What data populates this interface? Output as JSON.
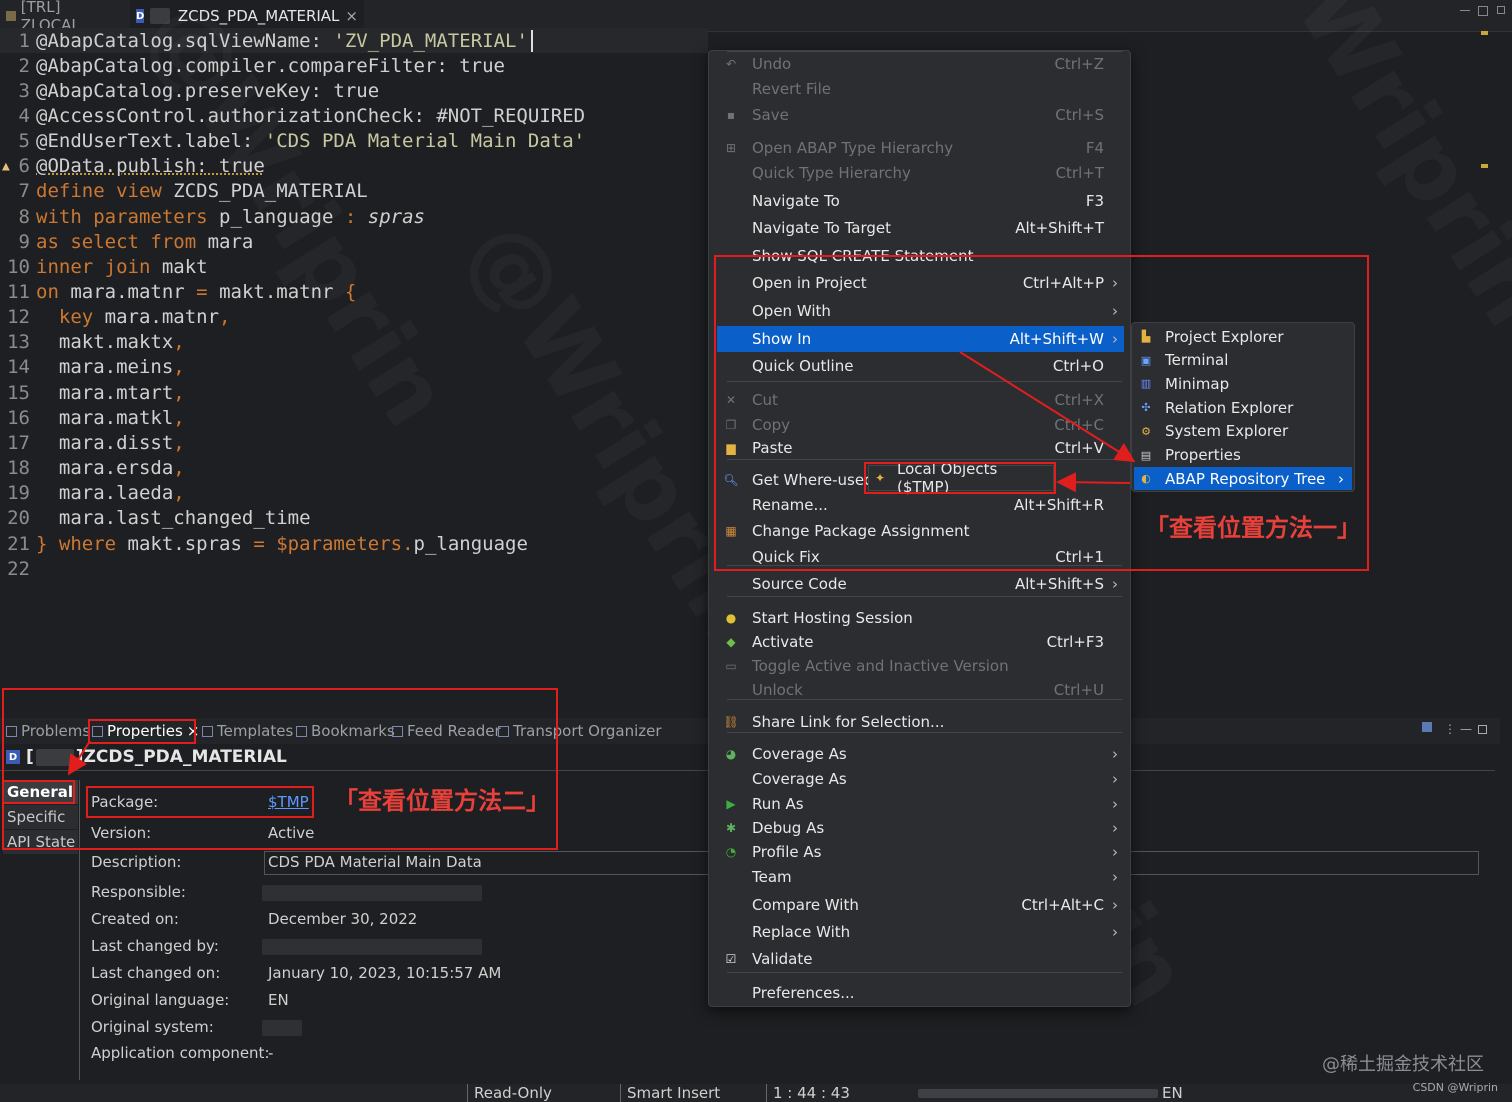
{
  "tabs": {
    "inactive_label": "[TRL] ZLOCAL",
    "active_icon": "D",
    "active_label": "ZCDS_PDA_MATERIAL",
    "close": "×"
  },
  "editor": {
    "lines": [
      {
        "n": "1",
        "parts": [
          {
            "t": "@AbapCatalog.sqlViewName: ",
            "c": "code"
          },
          {
            "t": "'ZV_PDA_MATERIAL'",
            "c": "s"
          }
        ],
        "current": true,
        "marker": "◦"
      },
      {
        "n": "2",
        "parts": [
          {
            "t": "@AbapCatalog.compiler.compareFilter: true",
            "c": "code"
          }
        ]
      },
      {
        "n": "3",
        "parts": [
          {
            "t": "@AbapCatalog.preserveKey: true",
            "c": "code"
          }
        ]
      },
      {
        "n": "4",
        "parts": [
          {
            "t": "@AccessControl.authorizationCheck: #NOT_REQUIRED",
            "c": "code"
          }
        ]
      },
      {
        "n": "5",
        "parts": [
          {
            "t": "@EndUserText.label: ",
            "c": "code"
          },
          {
            "t": "'CDS PDA Material Main Data'",
            "c": "s"
          }
        ]
      },
      {
        "n": "6",
        "parts": [
          {
            "t": "@OData.publish: true",
            "c": "code"
          }
        ],
        "warn": true
      },
      {
        "n": "7",
        "parts": [
          {
            "t": "define view ",
            "c": "k"
          },
          {
            "t": "ZCDS_PDA_MATERIAL",
            "c": "code"
          }
        ]
      },
      {
        "n": "8",
        "parts": [
          {
            "t": "with parameters ",
            "c": "k"
          },
          {
            "t": "p_language ",
            "c": "code"
          },
          {
            "t": ": ",
            "c": "k"
          },
          {
            "t": "spras",
            "c": "code it"
          }
        ]
      },
      {
        "n": "9",
        "parts": [
          {
            "t": "as select from ",
            "c": "k"
          },
          {
            "t": "mara",
            "c": "code"
          }
        ]
      },
      {
        "n": "10",
        "parts": [
          {
            "t": "inner join ",
            "c": "k"
          },
          {
            "t": "makt",
            "c": "code"
          }
        ]
      },
      {
        "n": "11",
        "parts": [
          {
            "t": "on ",
            "c": "k"
          },
          {
            "t": "mara.matnr ",
            "c": "code"
          },
          {
            "t": "= ",
            "c": "k"
          },
          {
            "t": "makt.matnr ",
            "c": "code"
          },
          {
            "t": "{",
            "c": "k"
          }
        ]
      },
      {
        "n": "12",
        "parts": [
          {
            "t": "  key ",
            "c": "k"
          },
          {
            "t": "mara.matnr",
            "c": "code"
          },
          {
            "t": ",",
            "c": "k"
          }
        ]
      },
      {
        "n": "13",
        "parts": [
          {
            "t": "  makt.maktx",
            "c": "code"
          },
          {
            "t": ",",
            "c": "k"
          }
        ]
      },
      {
        "n": "14",
        "parts": [
          {
            "t": "  mara.meins",
            "c": "code"
          },
          {
            "t": ",",
            "c": "k"
          }
        ]
      },
      {
        "n": "15",
        "parts": [
          {
            "t": "  mara.mtart",
            "c": "code"
          },
          {
            "t": ",",
            "c": "k"
          }
        ]
      },
      {
        "n": "16",
        "parts": [
          {
            "t": "  mara.matkl",
            "c": "code"
          },
          {
            "t": ",",
            "c": "k"
          }
        ]
      },
      {
        "n": "17",
        "parts": [
          {
            "t": "  mara.disst",
            "c": "code"
          },
          {
            "t": ",",
            "c": "k"
          }
        ]
      },
      {
        "n": "18",
        "parts": [
          {
            "t": "  mara.ersda",
            "c": "code"
          },
          {
            "t": ",",
            "c": "k"
          }
        ]
      },
      {
        "n": "19",
        "parts": [
          {
            "t": "  mara.laeda",
            "c": "code"
          },
          {
            "t": ",",
            "c": "k"
          }
        ]
      },
      {
        "n": "20",
        "parts": [
          {
            "t": "  mara.last_changed_time",
            "c": "code"
          }
        ]
      },
      {
        "n": "21",
        "parts": [
          {
            "t": "} where ",
            "c": "k"
          },
          {
            "t": "makt.spras ",
            "c": "code"
          },
          {
            "t": "= $parameters.",
            "c": "k"
          },
          {
            "t": "p_language",
            "c": "code"
          }
        ]
      },
      {
        "n": "22",
        "parts": []
      }
    ]
  },
  "context_menu": {
    "items": [
      {
        "label": "Undo",
        "shortcut": "Ctrl+Z",
        "disabled": true,
        "icon": "undo-icon",
        "glyph": "↶"
      },
      {
        "label": "Revert File",
        "shortcut": "",
        "disabled": true
      },
      {
        "label": "Save",
        "shortcut": "Ctrl+S",
        "disabled": true,
        "icon": "save-icon",
        "glyph": "▪"
      },
      {
        "sep": true
      },
      {
        "label": "Open ABAP Type Hierarchy",
        "shortcut": "F4",
        "disabled": true,
        "icon": "hierarchy-icon",
        "glyph": "⊞"
      },
      {
        "label": "Quick Type Hierarchy",
        "shortcut": "Ctrl+T",
        "disabled": true
      },
      {
        "label": "Navigate To",
        "shortcut": "F3"
      },
      {
        "label": "Navigate To Target",
        "shortcut": "Alt+Shift+T"
      },
      {
        "label": "Show SQL CREATE Statement",
        "shortcut": ""
      },
      {
        "label": "Open in Project",
        "shortcut": "Ctrl+Alt+P",
        "submenu": true
      },
      {
        "label": "Open With",
        "shortcut": "",
        "submenu": true
      },
      {
        "label": "Show In",
        "shortcut": "Alt+Shift+W",
        "submenu": true,
        "highlight": true
      },
      {
        "label": "Quick Outline",
        "shortcut": "Ctrl+O"
      },
      {
        "sep": true
      },
      {
        "label": "Cut",
        "shortcut": "Ctrl+X",
        "disabled": true,
        "icon": "cut-icon",
        "glyph": "✕"
      },
      {
        "label": "Copy",
        "shortcut": "Ctrl+C",
        "disabled": true,
        "icon": "copy-icon",
        "glyph": "❐"
      },
      {
        "label": "Paste",
        "shortcut": "Ctrl+V",
        "icon": "paste-icon",
        "glyph": "▆",
        "iconColor": "#e3b341"
      },
      {
        "sep": true
      },
      {
        "label": "Get Where-used",
        "shortcut": "",
        "icon": "search-icon",
        "glyph": "🔍︎",
        "iconColor": "#6aa0ff"
      },
      {
        "label": "Rename...",
        "shortcut": "Alt+Shift+R"
      },
      {
        "label": "Change Package Assignment",
        "shortcut": "",
        "icon": "package-icon",
        "glyph": "▦",
        "iconColor": "#d08a3a"
      },
      {
        "label": "Quick Fix",
        "shortcut": "Ctrl+1"
      },
      {
        "sep": true
      },
      {
        "label": "Source Code",
        "shortcut": "Alt+Shift+S",
        "submenu": true
      },
      {
        "sep": true
      },
      {
        "label": "Start Hosting Session",
        "shortcut": "",
        "icon": "hosting-icon",
        "glyph": "●",
        "iconColor": "#e0c030"
      },
      {
        "label": "Activate",
        "shortcut": "Ctrl+F3",
        "icon": "activate-icon",
        "glyph": "◆",
        "iconColor": "#6fbf4a"
      },
      {
        "label": "Toggle Active and Inactive Version",
        "shortcut": "",
        "disabled": true,
        "icon": "toggle-icon",
        "glyph": "▭"
      },
      {
        "label": "Unlock",
        "shortcut": "Ctrl+U",
        "disabled": true
      },
      {
        "sep": true
      },
      {
        "label": "Share Link for Selection...",
        "shortcut": "",
        "icon": "link-icon",
        "glyph": "⛓",
        "iconColor": "#d08a3a"
      },
      {
        "sep": true
      },
      {
        "label": "Coverage As",
        "shortcut": "",
        "submenu": true,
        "icon": "coverage-icon",
        "glyph": "◕",
        "iconColor": "#5fb35f"
      },
      {
        "label": "Coverage As",
        "shortcut": "",
        "submenu": true
      },
      {
        "label": "Run As",
        "shortcut": "",
        "submenu": true,
        "icon": "run-icon",
        "glyph": "▶",
        "iconColor": "#3fae3f"
      },
      {
        "label": "Debug As",
        "shortcut": "",
        "submenu": true,
        "icon": "debug-icon",
        "glyph": "✱",
        "iconColor": "#5fb35f"
      },
      {
        "label": "Profile As",
        "shortcut": "",
        "submenu": true,
        "icon": "profile-icon",
        "glyph": "◔",
        "iconColor": "#3fae3f"
      },
      {
        "label": "Team",
        "shortcut": "",
        "submenu": true
      },
      {
        "label": "Compare With",
        "shortcut": "Ctrl+Alt+C",
        "submenu": true
      },
      {
        "label": "Replace With",
        "shortcut": "",
        "submenu": true
      },
      {
        "label": "Validate",
        "shortcut": "",
        "icon": "validate-icon",
        "glyph": "☑"
      },
      {
        "sep": true
      },
      {
        "label": "Preferences...",
        "shortcut": ""
      }
    ],
    "submenu_arrow": "›"
  },
  "show_in_submenu": {
    "items": [
      {
        "label": "Project Explorer",
        "icon": "project-explorer-icon",
        "glyph": "▙",
        "color": "#e3b341"
      },
      {
        "label": "Terminal",
        "icon": "terminal-icon",
        "glyph": "▣",
        "color": "#6aa0ff"
      },
      {
        "label": "Minimap",
        "icon": "minimap-icon",
        "glyph": "▥",
        "color": "#6a8cff"
      },
      {
        "label": "Relation Explorer",
        "icon": "relation-explorer-icon",
        "glyph": "✣",
        "color": "#6aa0ff"
      },
      {
        "label": "System Explorer",
        "icon": "system-explorer-icon",
        "glyph": "⚙",
        "color": "#e3b341"
      },
      {
        "label": "Properties",
        "icon": "properties-icon",
        "glyph": "▤",
        "color": "#cccccc"
      },
      {
        "label": "ABAP Repository Tree",
        "icon": "repository-tree-icon",
        "glyph": "◐",
        "color": "#e3b341",
        "highlight": true
      }
    ]
  },
  "where_used_popup": {
    "label": "Local Objects ($TMP)"
  },
  "annotations": {
    "method_one": "「查看位置方法一」",
    "method_two": "「查看位置方法二」"
  },
  "bottom_tabs": [
    {
      "label": "Problems",
      "icon": "problems-icon"
    },
    {
      "label": "Properties",
      "icon": "properties-tab-icon",
      "active": true,
      "close": "×"
    },
    {
      "label": "Templates",
      "icon": "templates-icon"
    },
    {
      "label": "Bookmarks",
      "icon": "bookmarks-icon"
    },
    {
      "label": "Feed Reader",
      "icon": "feed-reader-icon"
    },
    {
      "label": "Transport Organizer",
      "icon": "transport-organizer-icon"
    }
  ],
  "properties": {
    "title_icon": "D",
    "title_open": "[",
    "title_close": "]",
    "title": "ZCDS_PDA_MATERIAL",
    "side_tabs": [
      "General",
      "Specific",
      "API State"
    ],
    "rows": [
      {
        "label": "Package:",
        "value": "$TMP",
        "link": true
      },
      {
        "label": "Version:",
        "value": "Active"
      },
      {
        "label": "Description:",
        "value": "CDS PDA Material Main Data"
      },
      {
        "label": "Responsible:",
        "value": ""
      },
      {
        "label": "Created on:",
        "value": "December 30, 2022"
      },
      {
        "label": "Last changed by:",
        "value": ""
      },
      {
        "label": "Last changed on:",
        "value": "January 10, 2023, 10:15:57 AM"
      },
      {
        "label": "Original language:",
        "value": "EN"
      },
      {
        "label": "Original system:",
        "value": ""
      },
      {
        "label": "Application component:",
        "value": "-"
      }
    ]
  },
  "status_bar": {
    "mode": "Read-Only",
    "insert": "Smart Insert",
    "position": "1 : 44 : 43",
    "lang": "EN"
  },
  "watermarks": {
    "site": "@稀土掘金技术社区",
    "csdn": "CSDN @Wriprin",
    "diagonal": "@Wriprin"
  }
}
